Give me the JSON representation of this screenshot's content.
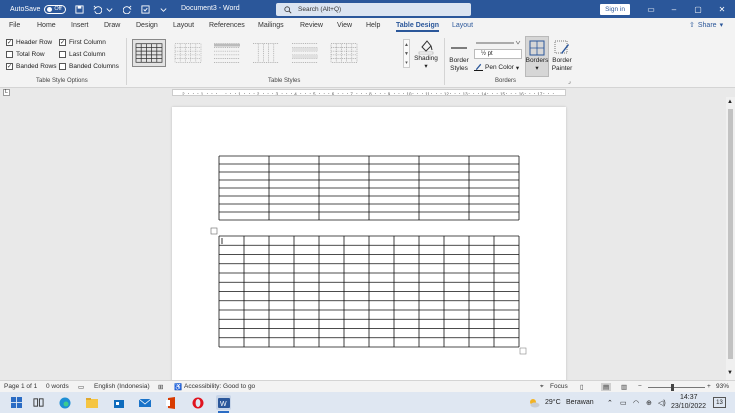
{
  "titlebar": {
    "autosave_label": "AutoSave",
    "autosave_state": "Off",
    "doc_title": "Document3 - Word",
    "search_placeholder": "Search (Alt+Q)",
    "signin_label": "Sign in"
  },
  "tabs": [
    "File",
    "Home",
    "Insert",
    "Draw",
    "Design",
    "Layout",
    "References",
    "Mailings",
    "Review",
    "View",
    "Help",
    "Table Design",
    "Layout"
  ],
  "share_label": "Share",
  "ribbon": {
    "style_options": {
      "group_label": "Table Style Options",
      "checks": [
        {
          "label": "Header Row",
          "checked": true
        },
        {
          "label": "First Column",
          "checked": true
        },
        {
          "label": "Total Row",
          "checked": false
        },
        {
          "label": "Last Column",
          "checked": false
        },
        {
          "label": "Banded Rows",
          "checked": true
        },
        {
          "label": "Banded Columns",
          "checked": false
        }
      ]
    },
    "table_styles": {
      "group_label": "Table Styles"
    },
    "shading_label": "Shading",
    "borders": {
      "group_label": "Borders",
      "border_styles_label": [
        "Border",
        "Styles"
      ],
      "weight": "½ pt",
      "pen_color_label": "Pen Color",
      "borders_label": "Borders",
      "painter_label": [
        "Border",
        "Painter"
      ]
    }
  },
  "statusbar": {
    "page": "Page 1 of 1",
    "words": "0 words",
    "language": "English (Indonesia)",
    "accessibility": "Accessibility: Good to go",
    "focus": "Focus",
    "zoom": "93%"
  },
  "taskbar": {
    "temperature": "29°C",
    "weather": "Berawan",
    "time": "14:37",
    "date": "23/10/2022",
    "notif_count": "13"
  },
  "tables": [
    {
      "rows": 8,
      "cols": 6
    },
    {
      "rows": 12,
      "cols": 12
    }
  ]
}
